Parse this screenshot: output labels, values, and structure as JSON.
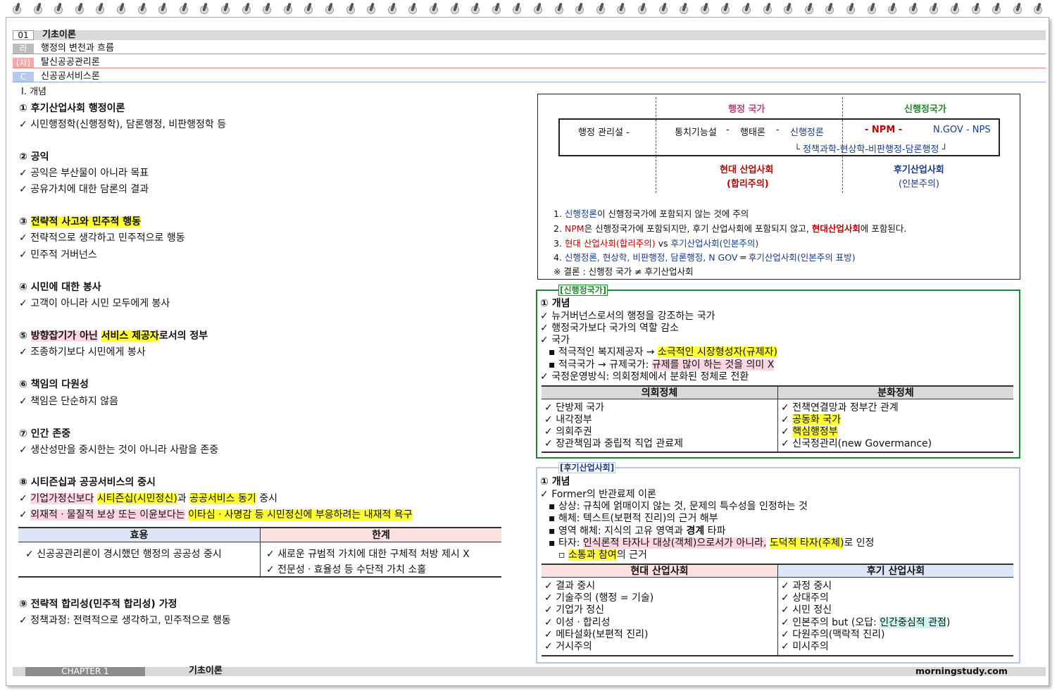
{
  "header": {
    "row1_num": "01",
    "row1_title": "기초이론",
    "row2_num": "라",
    "row2_title": "행정의 변천과 흐름",
    "row3_num": "(차)",
    "row3_title": "탈신공공관리론",
    "row4_num": "C",
    "row4_title": "신공공서비스론"
  },
  "left": {
    "section": "Ⅰ. 개념",
    "items": [
      {
        "title": "① 후기산업사회 행정이론",
        "lines": [
          "시민행정학(신행정학), 담론행정, 비판행정학 등"
        ]
      },
      {
        "title": "② 공익",
        "lines": [
          "공익은 부산물이 아니라 목표",
          "공유가치에 대한 담론의 결과"
        ]
      },
      {
        "title_prefix": "③ ",
        "title_hl": "전략적 사고와 민주적 행동",
        "lines": [
          "전략적으로 생각하고 민주적으로 행동",
          "민주적 거버넌스"
        ]
      },
      {
        "title": "④ 시민에 대한 봉사",
        "lines": [
          "고객이 아니라 시민 모두에게 봉사"
        ]
      },
      {
        "title_prefix": "⑤ ",
        "title_hl1": "방향잡기가 아닌",
        "title_mid": " ",
        "title_hl2": "서비스 제공자",
        "title_suffix": "로서의 정부",
        "lines": [
          "조종하기보다 시민에게 봉사"
        ]
      },
      {
        "title": "⑥ 책임의 다원성",
        "lines": [
          "책임은 단순하지 않음"
        ]
      },
      {
        "title": "⑦ 인간 존중",
        "lines": [
          "생산성만을 중시한는 것이 아니라 사람을 존중"
        ]
      },
      {
        "title": "⑧ 시티즌십과 공공서비스의 중시",
        "line1_a": "기업가정신보다",
        "line1_b": "시티즌십(시민정신)",
        "line1_c": "과",
        "line1_d": "공공서비스 동기",
        "line1_e": " 중시",
        "line2_a": "외재적ㆍ물질적 보상 또는 이윤보다는",
        "line2_b": "이타심ㆍ사명감 등 시민정신에 부응하려는 내재적 욕구"
      },
      {
        "title": "⑨ 전략적 합리성(민주적 합리성) 가정",
        "lines": [
          "정책과정: 전력적으로 생각하고, 민주적으로 행동"
        ]
      }
    ],
    "table": {
      "h1": "효용",
      "h2": "한계",
      "c1": "신공공관리론이 경시했던 행정의 공공성 중시",
      "c2a": "새로운 규범적 가치에 대한 구체적 처방 제시 X",
      "c2b": "전문성ㆍ효율성 등 수단적 가치 소홀"
    }
  },
  "diagram": {
    "col_admin": "행정 국가",
    "col_new": "신행정국가",
    "row_a": "행정 관리설 -",
    "row_b": "통치기능설",
    "row_dash1": "-",
    "row_c": "행태론",
    "row_dash2": "-",
    "row_d": "신행정론",
    "row_e": "- NPM -",
    "row_f": "N.GOV - NPS",
    "sub": "└ 정책과학-현상학-비판행정-담론행정 ┘",
    "mod1": "현대 산업사회",
    "mod2": "(합리주의)",
    "post1": "후기산업사회",
    "post2": "(인본주의)",
    "notes": [
      {
        "n": "1.",
        "a": "신행정론",
        "b": "이 신행정국가에 포함되지 않는 것에 주의"
      },
      {
        "n": "2.",
        "a": "NPM",
        "b": "은 신행정국가에 포함되지만, 후기 산업사회에 포함되지 않고,",
        "c": "현대산업사회",
        "d": "에 포함된다."
      },
      {
        "n": "3.",
        "a": "현대 산업사회(합리주의)",
        "b": " vs ",
        "c": "후기산업사회(인본주의)"
      },
      {
        "n": "4.",
        "a": "신행정론, 현상학, 비판행정, 담론행정, N GOV",
        "b": " ═ ",
        "c": "후기산업사회(인본주의 표방)"
      },
      {
        "n": "※",
        "a": "결론 : 신행정 국가 ≠ 후기산업사회"
      }
    ]
  },
  "box1": {
    "label": "[신행정국가]",
    "title": "① 개념",
    "l1": "뉴거버넌스로서의 행정을 강조하는 국가",
    "l2": "행정국가보다 국가의 역할 감소",
    "l3": "국가",
    "s1a": "적극적인 복지제공자 →",
    "s1b": "소극적인 시장형성자(규제자)",
    "s2a": "적극국가 → 규제국가:",
    "s2b": "규제를 많이 하는 것을 의미 X",
    "l4": "국정운영방식: 의회정체에서 분화된 정체로 전환",
    "th1": "의회정체",
    "th2": "분화정체",
    "left": [
      "단방제 국가",
      "내각정부",
      "의회주권",
      "장관책임과 중립적 직업 관료제"
    ],
    "right1": "전책연결망과 정부간 관계",
    "right2": "공동화 국가",
    "right3": "핵심행정부",
    "right4": "신국정관리(new Govermance)"
  },
  "box2": {
    "label": "[후기산업사회]",
    "title": "① 개념",
    "l1": "Former의 반관료제 이론",
    "s1": "상상: 규칙에 얽매이지 않는 것, 문제의 특수성을 인정하는 것",
    "s2": "해체: 텍스트(보편적 진리)의 근거 해부",
    "s3a": "영역 해체: 지식의 고유 영역과",
    "s3b": "경계",
    "s3c": "타파",
    "s4a": "타자:",
    "s4b": "인식론적 타자나 대상(객체)으로서가 아니라,",
    "s4c": "도덕적 타자(주체)",
    "s4d": "로 인정",
    "s5a": "소통과 참여",
    "s5b": "의 근거",
    "th1": "현대 산업사회",
    "th2": "후기 산업사회",
    "left": [
      "결과 중시",
      "기술주의 (행정 = 기술)",
      "기업가 정신",
      "이성ㆍ합리성",
      "메타설화(보편적 진리)",
      "거시주의"
    ],
    "right": [
      "과정 중시",
      "상대주의",
      "시민 정신"
    ],
    "right4a": "인본주의 but (오답:",
    "right4b": "인간중심적 관점",
    "right4c": ")",
    "right5": "다원주의(맥락적 진리)",
    "right6": "미시주의"
  },
  "footer": {
    "chapter": "CHAPTER 1",
    "title": "기초이론",
    "site": "morningstudy.com"
  }
}
